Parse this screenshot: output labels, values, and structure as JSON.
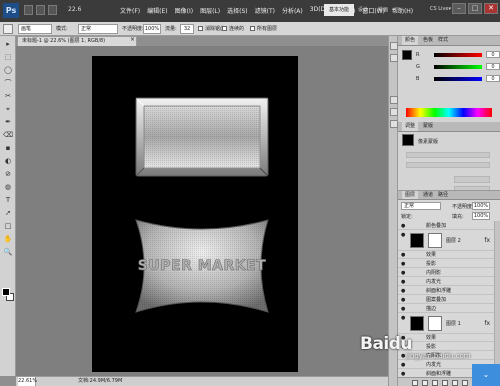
{
  "menubar": {
    "logo": "Ps",
    "zoom": "22.6",
    "menus": [
      "文件(F)",
      "编辑(E)",
      "图像(I)",
      "图层(L)",
      "选择(S)",
      "滤镜(T)",
      "分析(A)",
      "3D(D)",
      "视图(V)",
      "窗口(W)",
      "帮助(H)"
    ],
    "workspace_active": "基本功能",
    "workspace_2": "设计",
    "workspace_3": "绘画",
    "workspace_4": "»",
    "cs_live": "CS Live▾",
    "window_buttons": [
      "–",
      "□",
      "✕"
    ]
  },
  "options": {
    "brush_label": "画笔",
    "mode_label": "模式:",
    "mode_value": "正常",
    "opacity_label": "不透明度:",
    "opacity_value": "100%",
    "flow_label": "流量:",
    "flow_value": "32",
    "check_1": "消除锯齿",
    "check_2": "连续的",
    "check_3": "所有图层"
  },
  "document": {
    "tab_title": "未标题-1 @ 22.6% (图层 1, RGB/8)",
    "close": "×",
    "status_zoom": "22.61%",
    "status_doc": "文档:24.9M/6.79M"
  },
  "canvas": {
    "text_art": "SUPER MARKET"
  },
  "colors": {
    "canvas_bg": "#000000",
    "workspace_bg": "#7f7f7f",
    "accent": "#3d8edc"
  },
  "color_panel": {
    "tabs": [
      "颜色",
      "色板",
      "样式"
    ],
    "sliders": [
      {
        "label": "R",
        "value": "0",
        "color": "#cc2222"
      },
      {
        "label": "G",
        "value": "0",
        "color": "#22aa22"
      },
      {
        "label": "B",
        "value": "0",
        "color": "#2244cc"
      }
    ]
  },
  "adjust_panel": {
    "tabs": [
      "调整",
      "蒙版"
    ],
    "label": "像素蒙版"
  },
  "layers_panel": {
    "tabs": [
      "图层",
      "通道",
      "路径"
    ],
    "blend_mode": "正常",
    "opacity_label": "不透明度:",
    "opacity_value": "100%",
    "lock_label": "锁定:",
    "fill_label": "填充:",
    "fill_value": "100%",
    "rows": [
      {
        "eye": "●",
        "text": "颜色叠加",
        "big": false
      },
      {
        "eye": "●",
        "text": "图层 2",
        "big": true
      },
      {
        "eye": "●",
        "text": "效果",
        "big": false
      },
      {
        "eye": "●",
        "text": "投影",
        "big": false
      },
      {
        "eye": "●",
        "text": "内阴影",
        "big": false
      },
      {
        "eye": "●",
        "text": "内发光",
        "big": false
      },
      {
        "eye": "●",
        "text": "斜面和浮雕",
        "big": false
      },
      {
        "eye": "●",
        "text": "图案叠加",
        "big": false
      },
      {
        "eye": "●",
        "text": "描边",
        "big": false
      },
      {
        "eye": "●",
        "text": "图层 1",
        "big": true
      },
      {
        "eye": "●",
        "text": "效果",
        "big": false
      },
      {
        "eye": "●",
        "text": "投影",
        "big": false
      },
      {
        "eye": "●",
        "text": "内阴影",
        "big": false
      },
      {
        "eye": "●",
        "text": "内发光",
        "big": false
      },
      {
        "eye": "●",
        "text": "斜面和浮雕",
        "big": false
      },
      {
        "eye": "●",
        "text": "图案叠加",
        "big": false
      }
    ]
  },
  "watermark": {
    "main": "Baidu",
    "sub": "jingyan.baidu.com"
  },
  "tools": [
    "▸",
    "⬚",
    "◯",
    "⌒",
    "✂",
    "⌖",
    "✒",
    "⌫",
    "▪",
    "◐",
    "⊘",
    "◍",
    "T",
    "➚",
    "□",
    "✋",
    "🔍"
  ]
}
